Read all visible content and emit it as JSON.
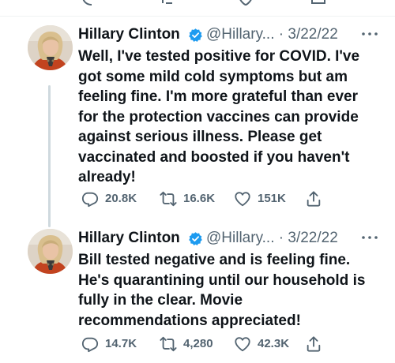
{
  "tweets": [
    {
      "author_name": "Hillary Clinton",
      "handle": "@Hillary...",
      "date": "3/22/22",
      "text": "Well, I've tested positive for COVID. I've\ngot some mild cold symptoms but am\nfeeling fine. I'm more grateful than ever\nfor the protection vaccines can provide\nagainst serious illness. Please get\nvaccinated and boosted if you haven't\nalready!",
      "replies": "20.8K",
      "retweets": "16.6K",
      "likes": "151K"
    },
    {
      "author_name": "Hillary Clinton",
      "handle": "@Hillary...",
      "date": "3/22/22",
      "text": "Bill tested negative and is feeling fine.\nHe's quarantining until our household is\nfully in the clear. Movie\nrecommendations appreciated!",
      "replies": "14.7K",
      "retweets": "4,280",
      "likes": "42.3K"
    }
  ],
  "separator": " · ",
  "colors": {
    "text": "#0f1419",
    "secondary": "#536471",
    "verified": "#1d9bf0",
    "thread_line": "#cfd9de",
    "divider": "#eff3f4"
  },
  "icons": [
    "verified-badge-icon",
    "more-icon",
    "reply-icon",
    "retweet-icon",
    "like-icon",
    "share-icon"
  ]
}
